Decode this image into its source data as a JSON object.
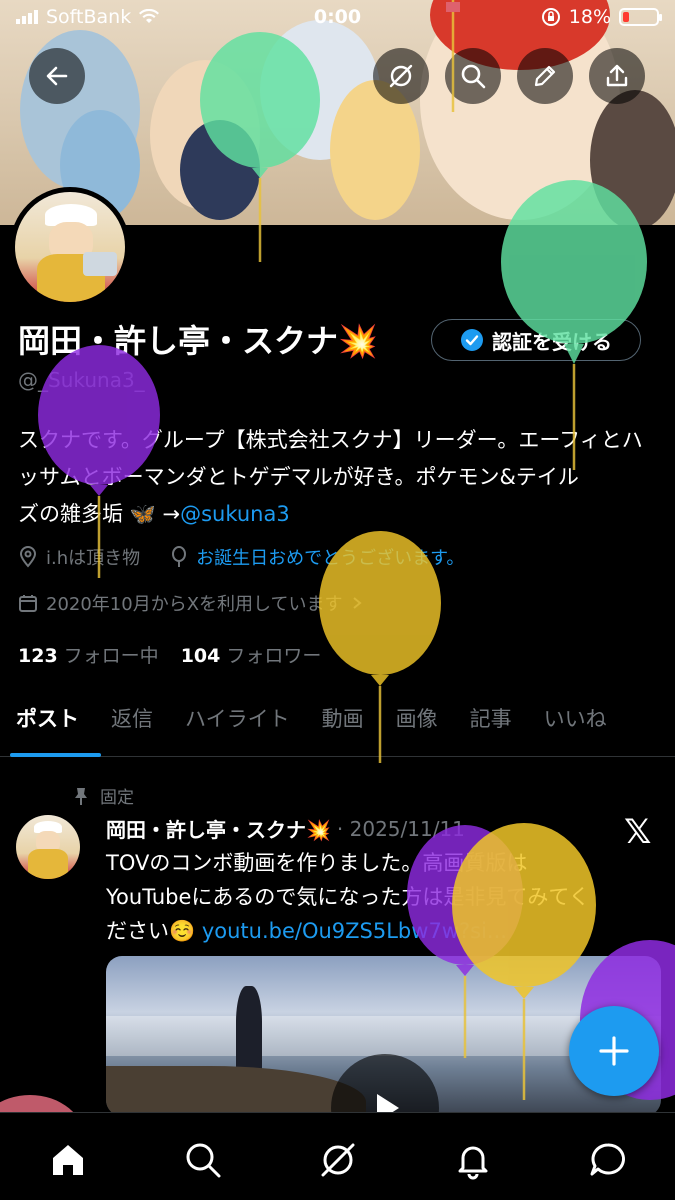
{
  "status_bar": {
    "carrier": "SoftBank",
    "time": "0:00",
    "battery": "18%"
  },
  "colors": {
    "accent": "#1d9bf0",
    "background": "#000000",
    "secondary_text": "#71767b",
    "balloon_green": "#5fe0a0",
    "balloon_purple": "#8e2be0",
    "balloon_yellow": "#f0c528"
  },
  "header_icons": [
    "back-arrow-icon",
    "grok-icon",
    "search-icon",
    "edit-pencil-icon",
    "share-icon"
  ],
  "profile": {
    "display_name": "岡田・許し亭・スクナ💥",
    "verify_button": "認証を受ける",
    "handle": "@_Sukuna3_",
    "bio_line1": "スクナです。グループ【株式会社スクナ】リーダー。エーフィとハ",
    "bio_line2": "ッサムとボーマンダとトゲデマルが好き。ポケモン&テイル",
    "bio_line3_prefix": "ズの雑多垢 🦋 →",
    "bio_link": "@sukuna3",
    "location": "i.hは頂き物",
    "birthday": "お誕生日おめでとうございます。",
    "joined": "2020年10月からXを利用しています",
    "following_count": "123",
    "following_label": "フォロー中",
    "followers_count": "104",
    "followers_label": "フォロワー"
  },
  "tabs": [
    "ポスト",
    "返信",
    "ハイライト",
    "動画",
    "画像",
    "記事",
    "いいね"
  ],
  "pinned_post": {
    "pinned_label": "固定",
    "author": "岡田・許し亭・スクナ💥",
    "date": "· 2025/11/11",
    "text_line1": "TOVのコンボ動画を作りました。高画質版は",
    "text_line2": "YouTubeにあるので気になった方は是非見てみてく",
    "text_line3_prefix": "ださい☺️ ",
    "link": "youtu.be/Ou9ZS5Lbw7w?si..."
  },
  "bottom_nav": [
    "home-icon",
    "search-icon",
    "grok-icon",
    "notifications-bell-icon",
    "messages-icon"
  ]
}
